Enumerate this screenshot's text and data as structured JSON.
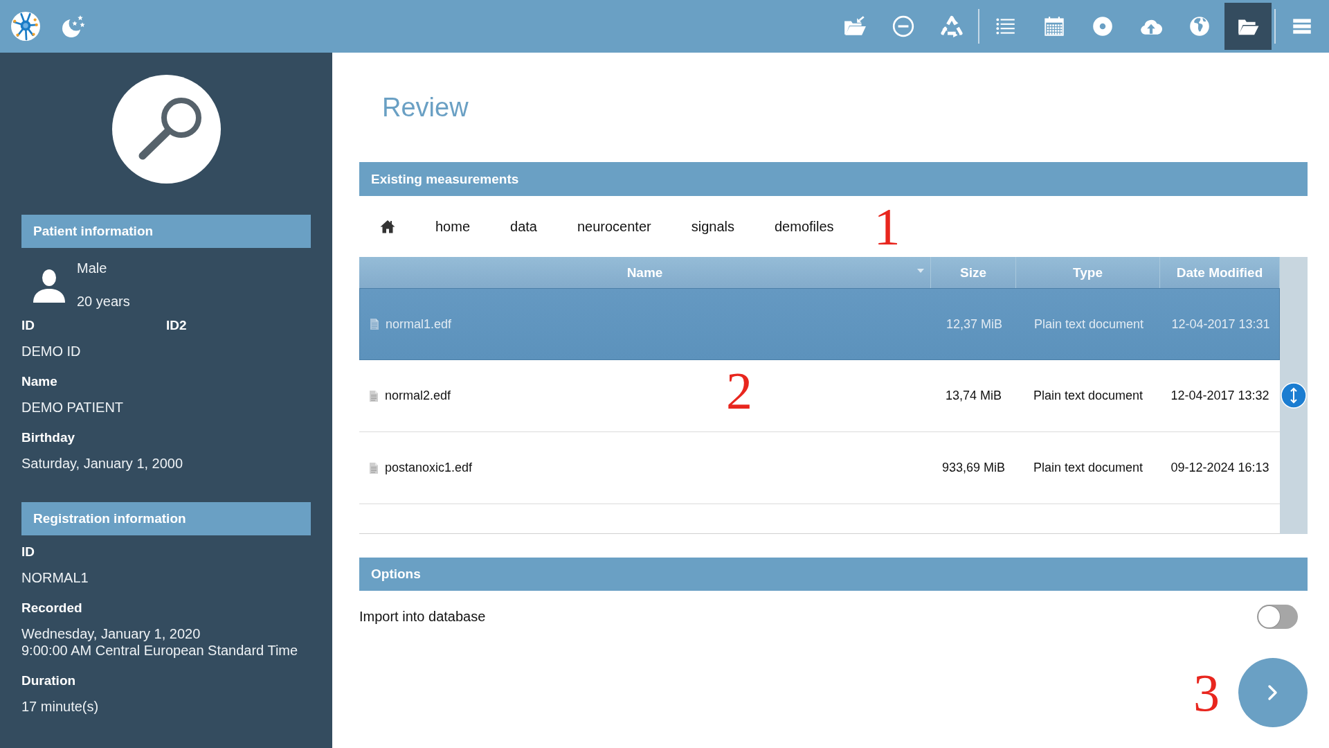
{
  "top_bar": {
    "tool_groups": [
      {
        "tools": [
          {
            "kind": "import",
            "selected": false
          },
          {
            "kind": "remove",
            "selected": false
          },
          {
            "kind": "recycle",
            "selected": false
          }
        ]
      },
      {
        "tools": [
          {
            "kind": "list",
            "selected": false
          },
          {
            "kind": "calendar",
            "selected": false
          },
          {
            "kind": "record",
            "selected": false
          },
          {
            "kind": "upload",
            "selected": false
          },
          {
            "kind": "globe",
            "selected": false
          },
          {
            "kind": "folder",
            "selected": true
          }
        ]
      },
      {
        "tools": [
          {
            "kind": "menu",
            "selected": false
          }
        ]
      }
    ]
  },
  "sidebar": {
    "patient": {
      "title": "Patient information",
      "sex": "Male",
      "age": "20 years",
      "ids": [
        {
          "label": "ID",
          "value": "DEMO ID"
        },
        {
          "label": "ID2"
        }
      ],
      "fields": [
        {
          "label": "Name",
          "lines": [
            "DEMO PATIENT"
          ]
        },
        {
          "label": "Birthday",
          "lines": [
            "Saturday, January 1, 2000"
          ]
        }
      ]
    },
    "registration": {
      "title": "Registration information",
      "fields": [
        {
          "label": "ID",
          "lines": [
            "NORMAL1"
          ]
        },
        {
          "label": "Recorded",
          "lines": [
            "Wednesday, January 1, 2020",
            "9:00:00 AM Central European Standard Time"
          ]
        },
        {
          "label": "Duration",
          "lines": [
            "17 minute(s)"
          ]
        }
      ]
    }
  },
  "main": {
    "title": "Review",
    "measurements": {
      "title": "Existing measurements",
      "breadcrumb": {
        "items": [
          "home",
          "data",
          "neurocenter",
          "signals",
          "demofiles"
        ],
        "annotation": "1"
      },
      "table": {
        "columns": [
          {
            "label": "Name",
            "sorted": true
          },
          {
            "label": "Size",
            "sorted": false
          },
          {
            "label": "Type",
            "sorted": false
          },
          {
            "label": "Date Modified",
            "sorted": false
          }
        ],
        "rows": [
          {
            "cells": [
              "normal1.edf",
              "12,37 MiB",
              "Plain text document",
              "12-04-2017 13:31"
            ],
            "selected": true
          },
          {
            "cells": [
              "normal2.edf",
              "13,74 MiB",
              "Plain text document",
              "12-04-2017 13:32"
            ],
            "selected": false,
            "annotation": "2"
          },
          {
            "cells": [
              "postanoxic1.edf",
              "933,69 MiB",
              "Plain text document",
              "09-12-2024 16:13"
            ],
            "selected": false
          }
        ]
      }
    },
    "options": {
      "title": "Options",
      "settings": [
        {
          "label": "Import into database",
          "on": false
        }
      ]
    },
    "footer": {
      "annotation": "3"
    }
  }
}
